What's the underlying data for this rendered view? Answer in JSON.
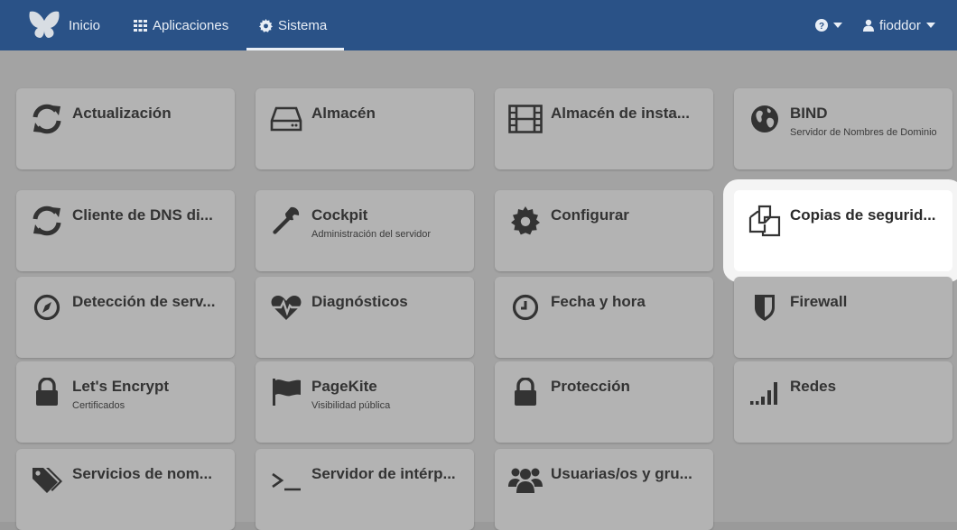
{
  "navbar": {
    "home_label": "Inicio",
    "apps_label": "Aplicaciones",
    "system_label": "Sistema",
    "user_label": "fioddor"
  },
  "colors": {
    "navbar_bg": "#2a5287",
    "tile_bg": "#b3b3b3",
    "highlight_bg": "#ffffff",
    "page_bg": "#a3a3a3"
  },
  "tiles": [
    {
      "title": "Actualización",
      "subtitle": "",
      "icon": "refresh-icon"
    },
    {
      "title": "Almacén",
      "subtitle": "",
      "icon": "hard-drive-icon"
    },
    {
      "title": "Almacén de insta...",
      "subtitle": "",
      "icon": "film-icon"
    },
    {
      "title": "BIND",
      "subtitle": "Servidor de Nombres de Dominio",
      "icon": "globe-icon"
    },
    {
      "title": "Cliente de DNS di...",
      "subtitle": "",
      "icon": "refresh-icon"
    },
    {
      "title": "Cockpit",
      "subtitle": "Administración del servidor",
      "icon": "wrench-icon"
    },
    {
      "title": "Configurar",
      "subtitle": "",
      "icon": "gear-icon"
    },
    {
      "title": "Copias de segurid...",
      "subtitle": "",
      "icon": "copy-icon"
    },
    {
      "title": "Detección de serv...",
      "subtitle": "",
      "icon": "compass-icon"
    },
    {
      "title": "Diagnósticos",
      "subtitle": "",
      "icon": "heartbeat-icon"
    },
    {
      "title": "Fecha y hora",
      "subtitle": "",
      "icon": "clock-icon"
    },
    {
      "title": "Firewall",
      "subtitle": "",
      "icon": "shield-icon"
    },
    {
      "title": "Let's Encrypt",
      "subtitle": "Certificados",
      "icon": "lock-icon"
    },
    {
      "title": "PageKite",
      "subtitle": "Visibilidad pública",
      "icon": "flag-icon"
    },
    {
      "title": "Protección",
      "subtitle": "",
      "icon": "lock-icon"
    },
    {
      "title": "Redes",
      "subtitle": "",
      "icon": "signal-icon"
    },
    {
      "title": "Servicios de nom...",
      "subtitle": "",
      "icon": "tags-icon"
    },
    {
      "title": "Servidor de intérp...",
      "subtitle": "",
      "icon": "terminal-icon"
    },
    {
      "title": "Usuarias/os y gru...",
      "subtitle": "",
      "icon": "users-icon"
    }
  ]
}
